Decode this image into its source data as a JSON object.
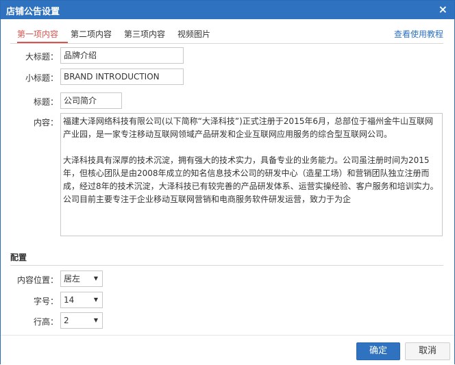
{
  "window": {
    "title": "店铺公告设置",
    "close_icon": "×"
  },
  "tabs": [
    {
      "label": "第一项内容",
      "active": true
    },
    {
      "label": "第二项内容",
      "active": false
    },
    {
      "label": "第三项内容",
      "active": false
    },
    {
      "label": "视频图片",
      "active": false
    }
  ],
  "help_link": "查看使用教程",
  "form": {
    "main_title_label": "大标题：",
    "main_title_value": "品牌介绍",
    "subtitle_label": "小标题：",
    "subtitle_value": "BRAND INTRODUCTION",
    "title_label": "标题：",
    "title_value": "公司简介",
    "content_label": "内容：",
    "content_value": "福建大泽网络科技有限公司(以下简称“大泽科技”)正式注册于2015年6月，总部位于福州金牛山互联网产业园，是一家专注移动互联网领域产品研发和企业互联网应用服务的综合型互联网公司。\n\n大泽科技具有深厚的技术沉淀，拥有强大的技术实力，具备专业的业务能力。公司虽注册时间为2015年，但核心团队是由2008年成立的知名信息技术公司的研发中心（造星工场）和营销团队独立注册而成，经过8年的技术沉淀，大泽科技已有较完善的产品研发体系、运营实操经验、客户服务和培训实力。公司目前主要专注于企业移动互联网营销和电商服务软件研发运营，致力于为企"
  },
  "config": {
    "section_title": "配置",
    "align_label": "内容位置：",
    "align_value": "居左",
    "font_size_label": "字号：",
    "font_size_value": "14",
    "line_height_label": "行高：",
    "line_height_value": "2",
    "caret_icon": "▼"
  },
  "footer": {
    "ok_label": "确定",
    "cancel_label": "取消"
  }
}
